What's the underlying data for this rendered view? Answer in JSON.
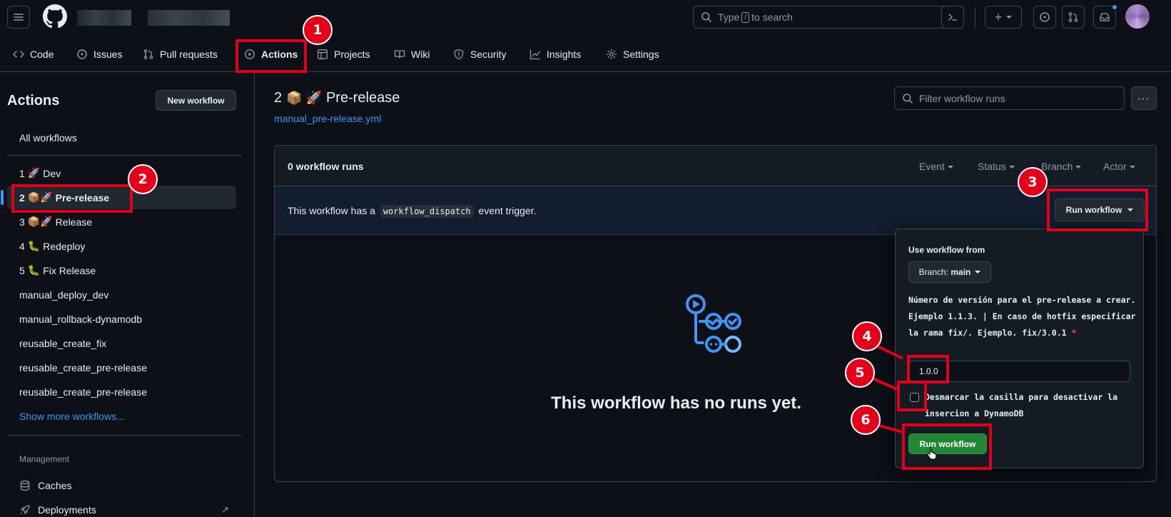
{
  "header": {
    "search_placeholder_pre": "Type",
    "search_key": "/",
    "search_placeholder_post": "to search",
    "plus_label": "+"
  },
  "repo_nav": [
    {
      "label": "Code",
      "icon": "code-icon"
    },
    {
      "label": "Issues",
      "icon": "issue-icon"
    },
    {
      "label": "Pull requests",
      "icon": "pull-request-icon"
    },
    {
      "label": "Actions",
      "icon": "play-icon",
      "active": true
    },
    {
      "label": "Projects",
      "icon": "table-icon"
    },
    {
      "label": "Wiki",
      "icon": "book-icon"
    },
    {
      "label": "Security",
      "icon": "shield-icon"
    },
    {
      "label": "Insights",
      "icon": "graph-icon"
    },
    {
      "label": "Settings",
      "icon": "gear-icon"
    }
  ],
  "sidebar": {
    "title": "Actions",
    "new_workflow_label": "New workflow",
    "all_workflows": "All workflows",
    "workflows": [
      {
        "num": "1",
        "emoji": "🚀",
        "name": "Dev"
      },
      {
        "num": "2",
        "emoji": "📦🚀",
        "name": "Pre-release",
        "selected": true
      },
      {
        "num": "3",
        "emoji": "📦🚀",
        "name": "Release"
      },
      {
        "num": "4",
        "emoji": "🐛",
        "name": "Redeploy"
      },
      {
        "num": "5",
        "emoji": "🐛",
        "name": "Fix Release"
      },
      {
        "name": "manual_deploy_dev"
      },
      {
        "name": "manual_rollback-dynamodb"
      },
      {
        "name": "reusable_create_fix"
      },
      {
        "name": "reusable_create_pre-release"
      },
      {
        "name": "reusable_create_pre-release"
      }
    ],
    "show_more": "Show more workflows...",
    "management_heading": "Management",
    "management": [
      {
        "label": "Caches",
        "icon": "database-icon"
      },
      {
        "label": "Deployments",
        "icon": "rocket-icon",
        "external": "↗"
      }
    ]
  },
  "main": {
    "title_num": "2",
    "title_emoji": "📦 🚀",
    "title_name": "Pre-release",
    "file": "manual_pre-release.yml",
    "filter_placeholder": "Filter workflow runs",
    "more_label": "···",
    "runs_count": "0 workflow runs",
    "filters": [
      "Event",
      "Status",
      "Branch",
      "Actor"
    ],
    "dispatch_pre": "This workflow has a",
    "dispatch_code": "workflow_dispatch",
    "dispatch_post": "event trigger.",
    "run_workflow_label": "Run workflow",
    "empty_message": "This workflow has no runs yet."
  },
  "dropdown": {
    "use_from": "Use workflow from",
    "branch_prefix": "Branch:",
    "branch": "main",
    "input_description": "Número de versión para el pre-release a crear. Ejemplo 1.1.3. | En caso de hotfix especificar la rama fix/. Ejemplo. fix/3.0.1",
    "required_mark": "*",
    "input_value": "1.0.0",
    "checkbox_label": "Desmarcar la casilla para desactivar la insercion a DynamoDB",
    "checkbox_checked": false,
    "run_button": "Run workflow"
  },
  "annotations": [
    "1",
    "2",
    "3",
    "4",
    "5",
    "6"
  ],
  "colors": {
    "background": "#0d1117",
    "accent_blue": "#4493f8",
    "annotation_red": "#e2001a",
    "run_green": "#238636",
    "tab_underline": "#f78166"
  }
}
